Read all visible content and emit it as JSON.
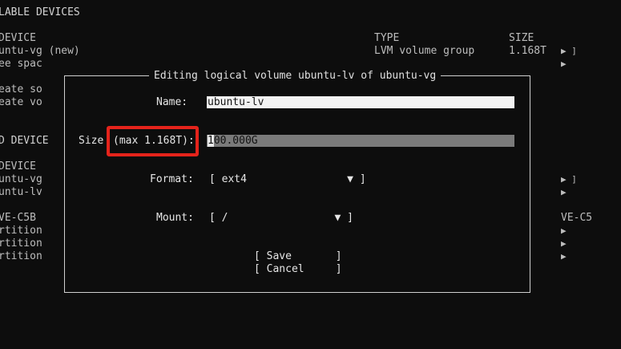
{
  "background": {
    "header": "LABLE DEVICES",
    "col_device": "DEVICE",
    "col_type": "TYPE",
    "col_size": "SIZE",
    "row1_name": "untu-vg (new)",
    "row1_type": "LVM volume group",
    "row1_size": "1.168T",
    "row1_arrow": "▶ ]",
    "row2_name": "ee spac",
    "row2_arrow": "▶",
    "action1": "eate so",
    "action2": "eate vo",
    "section2": "D DEVICE",
    "col_device2": "DEVICE",
    "used1": "untu-vg",
    "used1_arrow": "▶ ]",
    "used2": "untu-lv",
    "used2_arrow": "▶",
    "disk": "VE-C5B",
    "disk_suffix": "VE-C5",
    "part1": "rtition",
    "part2": "rtition",
    "part3": "rtition",
    "arrow_generic": "▶"
  },
  "dialog": {
    "title": "Editing logical volume ubuntu-lv of ubuntu-vg",
    "name_label": "Name:",
    "name_value": "ubuntu-lv",
    "size_label": "Size",
    "size_hint": "(max 1.168T):",
    "size_value": "100.000G",
    "format_label": "Format:",
    "format_value": "[ ext4                ▼ ]",
    "mount_label": "Mount:",
    "mount_value": "[ /                 ▼ ]",
    "save_button": "[ Save       ]",
    "cancel_button": "[ Cancel     ]"
  },
  "colors": {
    "highlight": "#e5231b",
    "background": "#0d0d0d"
  }
}
